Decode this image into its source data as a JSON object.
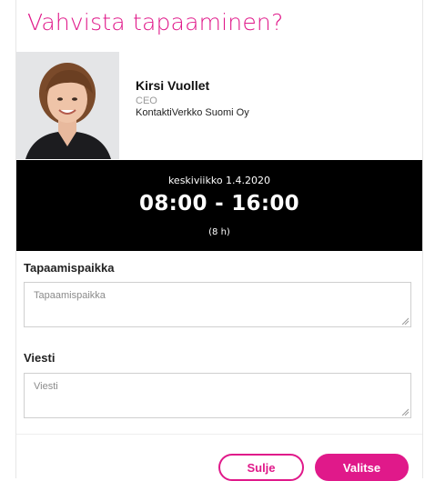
{
  "dialog": {
    "title": "Vahvista tapaaminen?"
  },
  "contact": {
    "name": "Kirsi Vuollet",
    "role": "CEO",
    "company": "KontaktiVerkko Suomi Oy"
  },
  "meeting": {
    "date": "keskiviikko 1.4.2020",
    "time": "08:00 - 16:00",
    "duration": "(8 h)"
  },
  "form": {
    "location_label": "Tapaamispaikka",
    "location_placeholder": "Tapaamispaikka",
    "message_label": "Viesti",
    "message_placeholder": "Viesti"
  },
  "actions": {
    "close_label": "Sulje",
    "select_label": "Valitse"
  },
  "colors": {
    "accent": "#e0198a",
    "time_background": "#000000"
  }
}
